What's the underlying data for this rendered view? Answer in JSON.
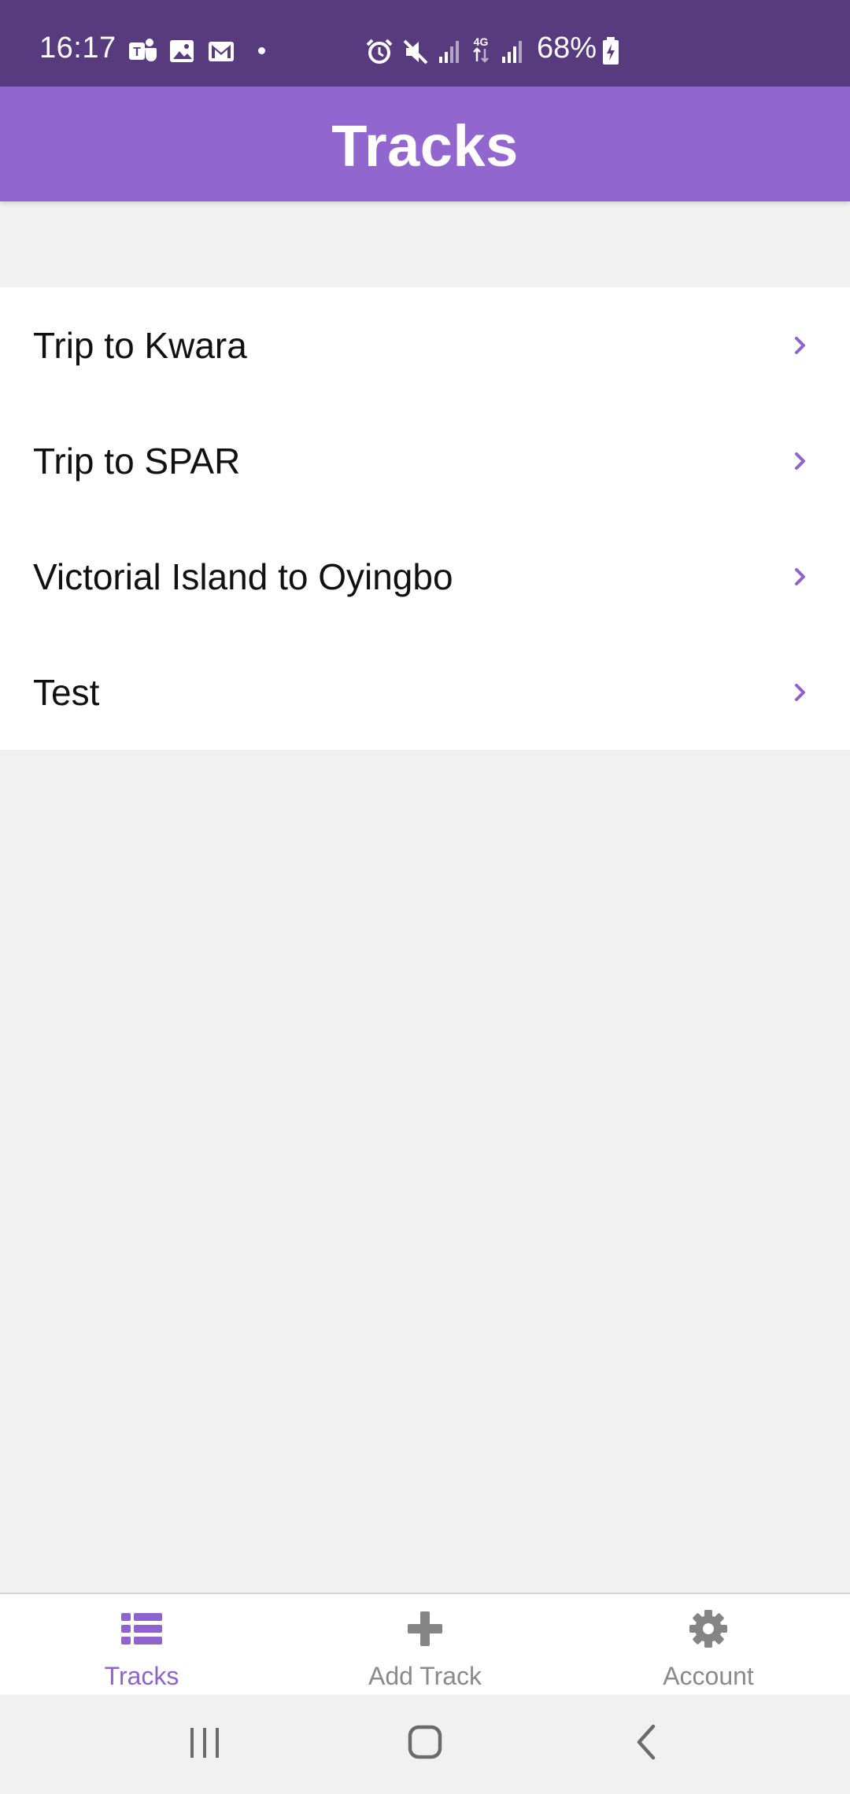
{
  "status_bar": {
    "time": "16:17",
    "battery": "68%",
    "network": "4G",
    "icons": [
      "teams-icon",
      "image-icon",
      "gmail-icon",
      "dot-icon",
      "alarm-icon",
      "mute-icon",
      "signal-icon",
      "data-4g-icon",
      "signal-icon",
      "battery-charging-icon"
    ]
  },
  "header": {
    "title": "Tracks"
  },
  "tracks": [
    {
      "label": "Trip to Kwara"
    },
    {
      "label": "Trip to SPAR"
    },
    {
      "label": "Victorial Island to Oyingbo"
    },
    {
      "label": "Test"
    }
  ],
  "bottom_nav": {
    "tabs": [
      {
        "label": "Tracks",
        "icon": "list-icon",
        "active": true
      },
      {
        "label": "Add Track",
        "icon": "plus-icon",
        "active": false
      },
      {
        "label": "Account",
        "icon": "gear-icon",
        "active": false
      }
    ]
  },
  "colors": {
    "status_bar": "#583b7e",
    "header": "#9266cf",
    "accent": "#8f63cc",
    "inactive": "#8a8a8a",
    "background": "#f1f1f1"
  },
  "system_nav": {
    "buttons": [
      "recent-apps-icon",
      "home-icon",
      "back-icon"
    ]
  }
}
